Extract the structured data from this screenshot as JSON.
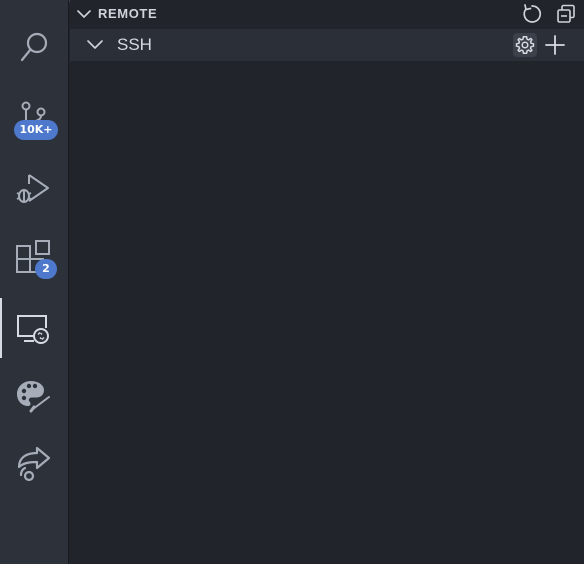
{
  "activity_bar": {
    "items": [
      {
        "id": "search",
        "icon": "search-icon"
      },
      {
        "id": "source-control",
        "icon": "source-control-icon",
        "badge": "10K+"
      },
      {
        "id": "run-and-debug",
        "icon": "run-debug-icon"
      },
      {
        "id": "extensions",
        "icon": "extensions-icon",
        "badge": "2"
      },
      {
        "id": "remote-explorer",
        "icon": "remote-explorer-icon",
        "active": true
      },
      {
        "id": "themes",
        "icon": "palette-icon"
      },
      {
        "id": "live-share",
        "icon": "live-share-icon"
      }
    ]
  },
  "sidebar": {
    "section_title": "REMOTE",
    "actions": {
      "refresh_icon": "refresh-icon",
      "collapse_icon": "collapse-all-icon"
    },
    "group": {
      "label": "SSH",
      "expanded": true,
      "actions": {
        "settings_icon": "gear-icon",
        "add_icon": "plus-icon"
      }
    }
  },
  "colors": {
    "activity_bar_bg": "#2c313a",
    "sidebar_bg": "#21252b",
    "row_bg": "#2b3038",
    "badge_bg": "#4d78cc",
    "icon_fg": "#a7adb8",
    "active_indicator": "#d7dae0"
  }
}
